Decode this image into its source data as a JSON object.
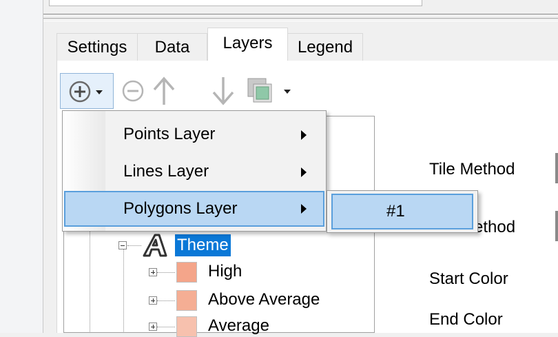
{
  "tabs": [
    {
      "label": "Settings",
      "active": false
    },
    {
      "label": "Data",
      "active": false
    },
    {
      "label": "Layers",
      "active": true
    },
    {
      "label": "Legend",
      "active": false
    }
  ],
  "toolbar": {
    "icons": [
      "add-icon",
      "dropdown-arrow-icon",
      "remove-icon",
      "move-up-icon",
      "move-down-icon",
      "layer-image-icon",
      "dropdown-arrow-icon"
    ]
  },
  "menu": {
    "items": [
      {
        "label": "Points Layer",
        "has_submenu": true,
        "highlighted": false
      },
      {
        "label": "Lines Layer",
        "has_submenu": true,
        "highlighted": false
      },
      {
        "label": "Polygons Layer",
        "has_submenu": true,
        "highlighted": true
      }
    ],
    "submenu": {
      "items": [
        {
          "label": "#1",
          "highlighted": true
        }
      ]
    }
  },
  "tree": {
    "theme": {
      "label": "Theme",
      "icon": "theme-icon"
    },
    "items": [
      {
        "label": "High",
        "color": "#f4a58a"
      },
      {
        "label": "Above Average",
        "color": "#f5ae94"
      },
      {
        "label": "Average",
        "color": "#f7c1ae"
      }
    ]
  },
  "properties": {
    "labels": [
      "Tile Method",
      "Color Method",
      "Start Color",
      "End Color"
    ]
  },
  "colors": {
    "highlight_fill": "#b9d7f3",
    "highlight_border": "#5a9fdc",
    "selection": "#0a78d7"
  }
}
